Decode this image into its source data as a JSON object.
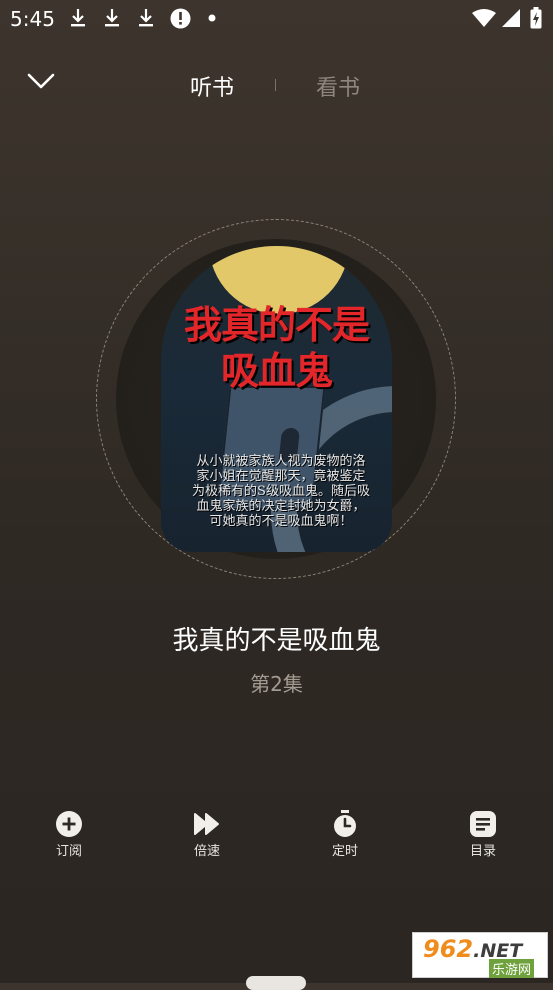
{
  "status_bar": {
    "time": "5:45",
    "icons": [
      "download-icon",
      "download-icon",
      "download-icon",
      "alert-icon",
      "dot-icon",
      "wifi-icon",
      "signal-icon",
      "battery-charging-icon"
    ]
  },
  "header": {
    "tab_listen": "听书",
    "tab_read": "看书"
  },
  "cover": {
    "title_line1": "我真的不是",
    "title_line2": "吸血鬼",
    "blurb": "从小就被家族人视为废物的洛家小姐在觉醒那天，竟被鉴定为极稀有的S级吸血鬼。随后吸血鬼家族的决定封她为女爵，可她真的不是吸血鬼啊！"
  },
  "book": {
    "title": "我真的不是吸血鬼",
    "episode": "第2集"
  },
  "actions": [
    {
      "label": "订阅",
      "icon": "plus-circle-icon"
    },
    {
      "label": "倍速",
      "icon": "fast-forward-icon"
    },
    {
      "label": "定时",
      "icon": "timer-icon"
    },
    {
      "label": "目录",
      "icon": "list-icon"
    }
  ],
  "watermark": {
    "big": "962",
    "net": ".NET",
    "small": "乐游网"
  }
}
